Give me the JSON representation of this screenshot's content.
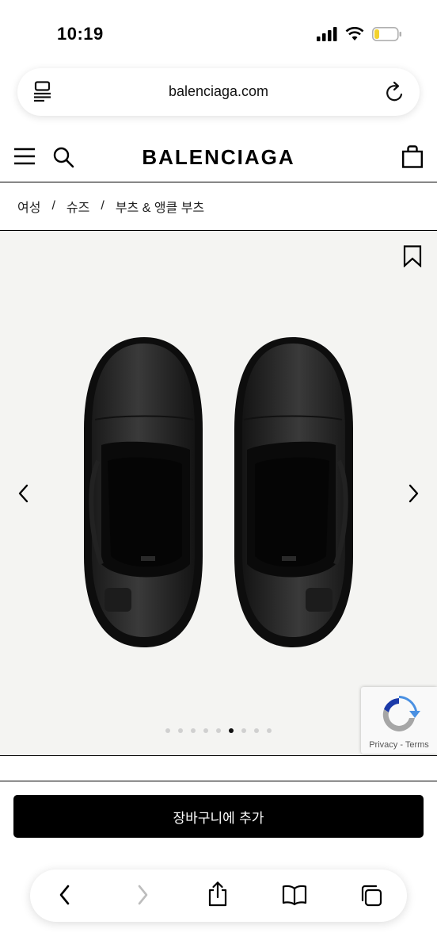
{
  "status_bar": {
    "time": "10:19"
  },
  "browser": {
    "url": "balenciaga.com"
  },
  "site": {
    "logo": "BALENCIAGA"
  },
  "breadcrumb": [
    {
      "label": "여성"
    },
    {
      "label": "슈즈"
    },
    {
      "label": "부츠 & 앵클 부츠"
    }
  ],
  "breadcrumb_separator": "/",
  "gallery": {
    "slide_count": 9,
    "active_slide": 6
  },
  "recaptcha": {
    "privacy": "Privacy",
    "sep": " - ",
    "terms": "Terms"
  },
  "actions": {
    "add_to_cart": "장바구니에 추가"
  },
  "icons": [
    "signal-icon",
    "wifi-icon",
    "battery-icon",
    "reader-icon",
    "reload-icon",
    "menu-icon",
    "search-icon",
    "bag-icon",
    "bookmark-icon",
    "chevron-left-icon",
    "chevron-right-icon",
    "share-icon",
    "book-icon",
    "tabs-icon"
  ]
}
